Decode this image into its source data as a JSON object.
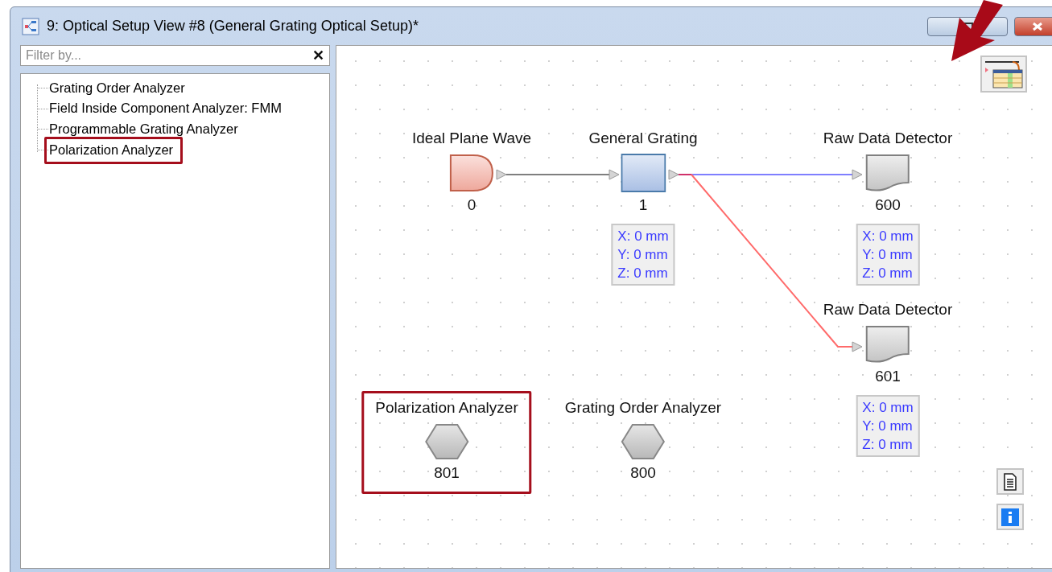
{
  "window": {
    "title": "9: Optical Setup View #8 (General Grating Optical Setup)*"
  },
  "filter": {
    "placeholder": "Filter by...",
    "clear": "✕"
  },
  "tree": [
    {
      "label": "Grating Order Analyzer",
      "highlighted": false
    },
    {
      "label": "Field Inside Component Analyzer: FMM",
      "highlighted": false
    },
    {
      "label": "Programmable Grating Analyzer",
      "highlighted": false
    },
    {
      "label": "Polarization Analyzer",
      "highlighted": true
    }
  ],
  "nodes": [
    {
      "kind": "source",
      "label": "Ideal Plane Wave",
      "number": "0",
      "highlighted": false
    },
    {
      "kind": "component",
      "label": "General Grating",
      "number": "1",
      "position": [
        "X: 0 mm",
        "Y: 0 mm",
        "Z: 0 mm"
      ],
      "highlighted": false
    },
    {
      "kind": "detector",
      "label": "Raw Data Detector",
      "number": "600",
      "position": [
        "X: 0 mm",
        "Y: 0 mm",
        "Z: 0 mm"
      ],
      "highlighted": false
    },
    {
      "kind": "detector",
      "label": "Raw Data Detector",
      "number": "601",
      "position": [
        "X: 0 mm",
        "Y: 0 mm",
        "Z: 0 mm"
      ],
      "highlighted": false
    },
    {
      "kind": "analyzer",
      "label": "Polarization Analyzer",
      "number": "801",
      "highlighted": true
    },
    {
      "kind": "analyzer",
      "label": "Grating Order Analyzer",
      "number": "800",
      "highlighted": false
    }
  ],
  "connections": [
    {
      "color": "#7f7f7f"
    },
    {
      "color": "#7f7fff"
    },
    {
      "color": "#ff6b6b"
    }
  ]
}
